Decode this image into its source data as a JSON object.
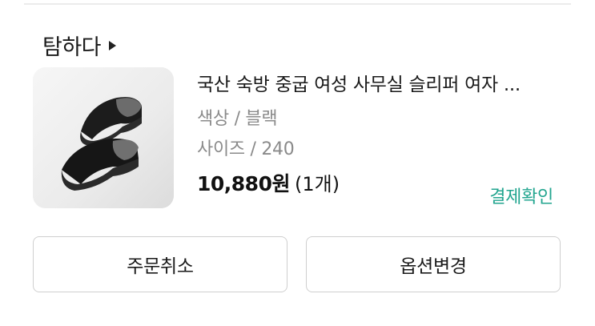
{
  "store": {
    "name": "탐하다",
    "arrow_icon": "caret-right-icon"
  },
  "product": {
    "title": "국산 숙방 중굽 여성 사무실 슬리퍼 여자 ...",
    "image_icon": "black-slipper-product-image",
    "color_option": "색상 / 블랙",
    "size_option": "사이즈 / 240",
    "price": "10,880원",
    "quantity": "(1개)"
  },
  "status_link": {
    "label": "결제확인",
    "color": "#22a58f"
  },
  "actions": {
    "cancel_label": "주문취소",
    "change_option_label": "옵션변경"
  }
}
